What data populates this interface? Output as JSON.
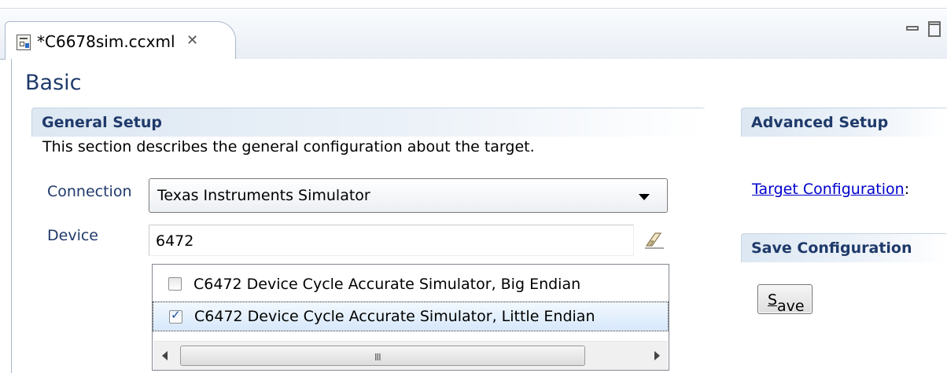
{
  "editor_tab": {
    "title": "*C6678sim.ccxml",
    "close_glyph": "✕"
  },
  "page": {
    "title": "Basic"
  },
  "general_setup": {
    "header": "General Setup",
    "description": "This section describes the general configuration about the target.",
    "connection": {
      "label": "Connection",
      "value": "Texas Instruments Simulator"
    },
    "device": {
      "label": "Device",
      "value": "6472",
      "options": [
        {
          "label": "C6472 Device Cycle Accurate Simulator, Big Endian",
          "checked": false
        },
        {
          "label": "C6472 Device Cycle Accurate Simulator, Little Endian",
          "checked": true
        }
      ],
      "scroll_grip": "III"
    }
  },
  "advanced_setup": {
    "header": "Advanced Setup",
    "link_text": "Target Configuration",
    "link_suffix": ":"
  },
  "save_configuration": {
    "header": "Save Configuration",
    "button_mnemonic": "S",
    "button_rest": "ave"
  },
  "colors": {
    "header_text": "#1f3a6a",
    "link": "#0000cc",
    "selection": "#d7e8fb"
  }
}
